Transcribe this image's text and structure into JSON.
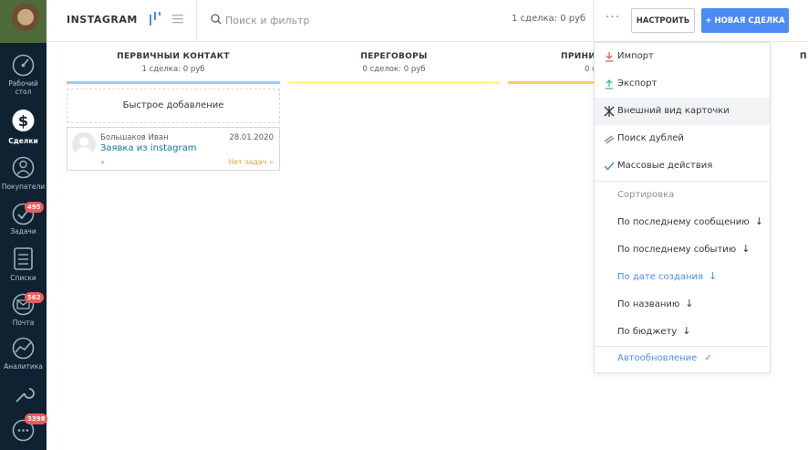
{
  "sidebar": {
    "items": [
      {
        "label_lines": [
          "Рабочий",
          "стол"
        ],
        "icon": "dashboard-icon"
      },
      {
        "label_lines": [
          "Сделки"
        ],
        "icon": "deals-icon"
      },
      {
        "label_lines": [
          "Покупатели"
        ],
        "icon": "customers-icon"
      },
      {
        "label_lines": [
          "Задачи"
        ],
        "icon": "tasks-icon",
        "badge": "495"
      },
      {
        "label_lines": [
          "Списки"
        ],
        "icon": "lists-icon"
      },
      {
        "label_lines": [
          "Почта"
        ],
        "icon": "mail-icon",
        "badge": "562"
      },
      {
        "label_lines": [
          "Аналитика"
        ],
        "icon": "analytics-icon"
      },
      {
        "label_lines": [],
        "icon": "settings-icon"
      },
      {
        "label_lines": [],
        "icon": "chat-icon",
        "badge": "3398"
      }
    ]
  },
  "header": {
    "title": "INSTAGRAM",
    "search_placeholder": "Поиск и фильтр",
    "deal_count": "1 сделка: 0 руб",
    "more_label": "···",
    "setup_label": "НАСТРОИТЬ",
    "new_deal_label": "+ НОВАЯ СДЕЛКА"
  },
  "columns": [
    {
      "title": "ПЕРВИЧНЫЙ КОНТАКТ",
      "summary": "1 сделка: 0 руб",
      "color": "#99ccff"
    },
    {
      "title": "ПЕРЕГОВОРЫ",
      "summary": "0 сделок: 0 руб",
      "color": "#fffd7f"
    },
    {
      "title": "ПРИНИ",
      "summary": "0 с",
      "color": "#ffcc66"
    },
    {
      "title": "П",
      "summary": "",
      "color": "#ffffff"
    }
  ],
  "quick_add": "Быстрое добавление",
  "deal": {
    "contact": "Большаков Иван",
    "date": "28.01.2020",
    "title": "Заявка из instagram",
    "link": "»",
    "tasks": "Нет задач »"
  },
  "menu": {
    "items": [
      {
        "label": "Импорт",
        "icon": "import-icon"
      },
      {
        "label": "Экспорт",
        "icon": "export-icon"
      },
      {
        "label": "Внешний вид карточки",
        "icon": "card-view-icon"
      },
      {
        "label": "Поиск дублей",
        "icon": "duplicates-icon"
      },
      {
        "label": "Массовые действия",
        "icon": "mass-actions-icon"
      }
    ],
    "sort_heading": "Сортировка",
    "sort_options": [
      {
        "label": "По последнему сообщению",
        "selected": false
      },
      {
        "label": "По последнему событию",
        "selected": false
      },
      {
        "label": "По дате создания",
        "selected": true
      },
      {
        "label": "По названию",
        "selected": false
      },
      {
        "label": "По бюджету",
        "selected": false
      }
    ],
    "autoupdate": "Автообновление",
    "autoupdate_check": "✓"
  },
  "colors": {
    "accent": "#4c8bf5",
    "sidebar_bg": "#0f2231",
    "badge": "#f25a5a",
    "link": "#1375ab",
    "no_tasks": "#e8a33d"
  }
}
